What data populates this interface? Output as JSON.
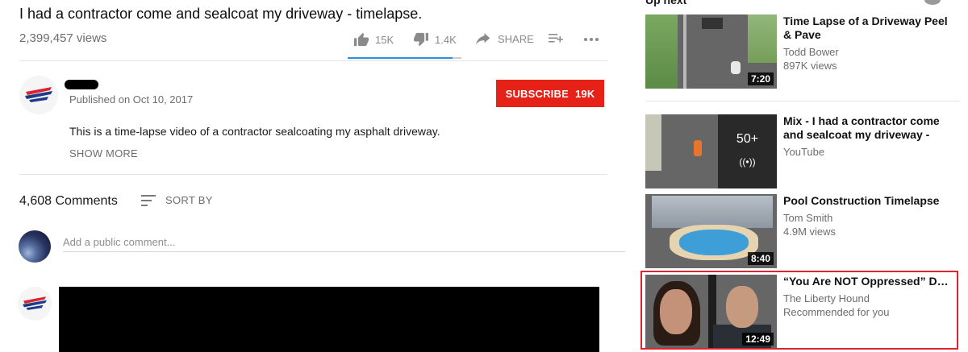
{
  "video": {
    "title": "I had a contractor come and sealcoat my driveway - timelapse.",
    "views": "2,399,457 views",
    "likes": "15K",
    "dislikes": "1.4K",
    "share_label": "SHARE",
    "like_ratio": 0.92
  },
  "owner": {
    "published": "Published on Oct 10, 2017",
    "subscribe_label": "SUBSCRIBE",
    "subscriber_count": "19K"
  },
  "description": {
    "text": "This is a time-lapse video of a contractor sealcoating my asphalt driveway.",
    "show_more": "SHOW MORE"
  },
  "comments": {
    "count": "4,608 Comments",
    "sort_label": "SORT BY",
    "input_placeholder": "Add a public comment..."
  },
  "sidebar": {
    "up_next": "Up next",
    "items": [
      {
        "title": "Time Lapse of a Driveway Peel & Pave",
        "channel": "Todd Bower",
        "meta": "897K views",
        "duration": "7:20"
      },
      {
        "title": "Mix - I had a contractor come and sealcoat my driveway - timelapse.",
        "channel": "YouTube",
        "meta": "",
        "count": "50+",
        "live_icon": "((•))"
      },
      {
        "title": "Pool Construction Timelapse",
        "channel": "Tom Smith",
        "meta": "4.9M views",
        "duration": "8:40"
      },
      {
        "title": "“You Are NOT Oppressed” Dave Rubin Calmly Destroys a Craze...",
        "channel": "The Liberty Hound",
        "meta": "Recommended for you",
        "duration": "12:49"
      }
    ]
  },
  "colors": {
    "subscribe_bg": "#e62117",
    "like_bar": "#2f8ed6",
    "highlight_border": "#d9262f"
  }
}
